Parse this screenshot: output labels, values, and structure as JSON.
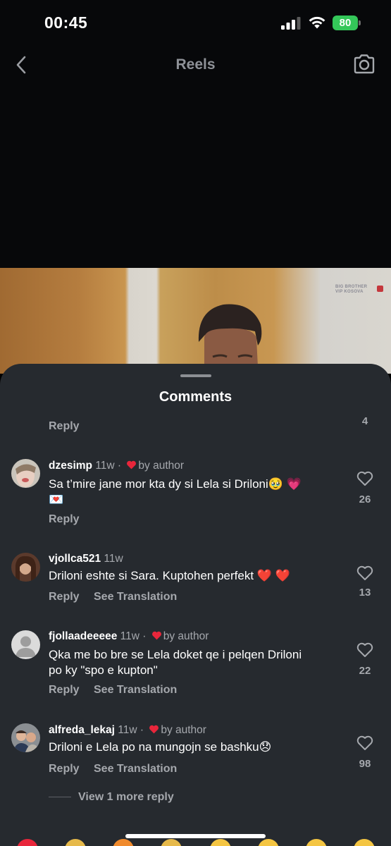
{
  "status_bar": {
    "time": "00:45",
    "battery": "80"
  },
  "nav": {
    "title": "Reels"
  },
  "video": {
    "watermark_line1": "BIG BROTHER",
    "watermark_line2": "VIP KOSOVA"
  },
  "comments_sheet": {
    "title": "Comments",
    "top_reply": {
      "reply_label": "Reply",
      "like_count": "4"
    },
    "comments": [
      {
        "username": "dzesimp",
        "age": "11w",
        "by_author": "by author",
        "text_line1": "Sa t’mire jane mor kta dy si Lela si Driloni🥹 💗",
        "text_line2": "💌",
        "reply_label": "Reply",
        "like_count": "26"
      },
      {
        "username": "vjollca521",
        "age": "11w",
        "text_line1": "Driloni eshte si Sara. Kuptohen perfekt ❤️ ❤️",
        "reply_label": "Reply",
        "see_translation": "See Translation",
        "like_count": "13"
      },
      {
        "username": "fjollaadeeeee",
        "age": "11w",
        "by_author": "by author",
        "text_line1": "Qka me bo bre se Lela doket qe i pelqen Driloni",
        "text_line2": "po ky \"spo e kupton\"",
        "reply_label": "Reply",
        "see_translation": "See Translation",
        "like_count": "22"
      },
      {
        "username": "alfreda_lekaj",
        "age": "11w",
        "by_author": "by author",
        "text_line1": "Driloni e Lela po na mungojn se bashku😞",
        "reply_label": "Reply",
        "see_translation": "See Translation",
        "like_count": "98"
      }
    ],
    "view_more_replies": "View 1 more reply"
  },
  "emoji_reactions": [
    "red-heart",
    "raising-hands",
    "fire",
    "clapping-hands",
    "crying-face",
    "heart-eyes-face",
    "open-mouth-face",
    "laughing-face"
  ],
  "colors": {
    "background": "#07080a",
    "sheet": "#262a2f",
    "secondary_text": "#a5a8ad",
    "like_red": "#e8263b",
    "battery_green": "#34c759"
  }
}
